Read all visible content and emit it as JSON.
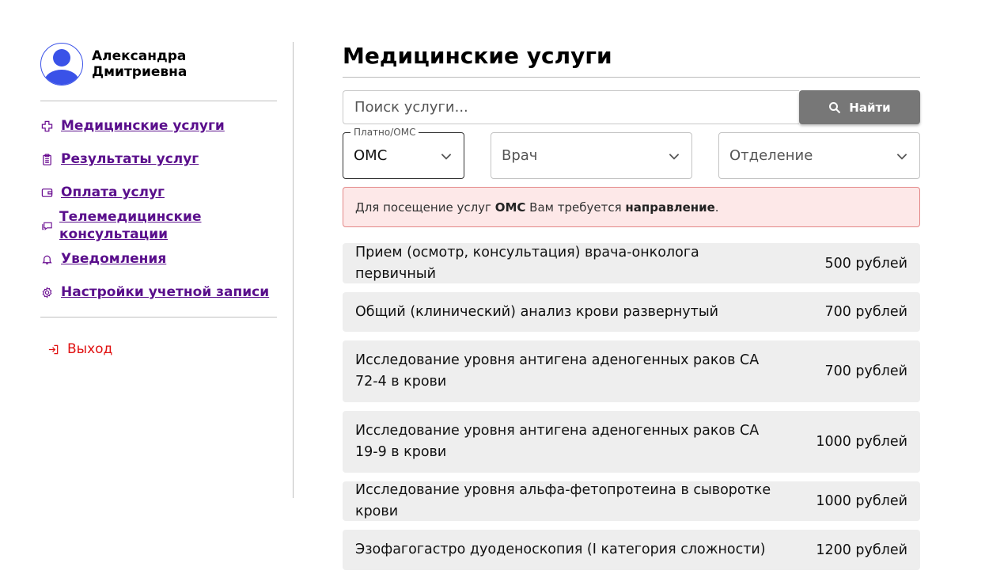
{
  "profile": {
    "name": "Александра Дмитриевна"
  },
  "nav": {
    "items": [
      {
        "label": "Медицинские услуги",
        "icon": "medical-cross-icon"
      },
      {
        "label": "Результаты услуг",
        "icon": "clipboard-icon"
      },
      {
        "label": "Оплата услуг",
        "icon": "wallet-icon"
      },
      {
        "label": "Телемедицинские консультации",
        "icon": "chat-icon"
      },
      {
        "label": "Уведомления",
        "icon": "bell-icon"
      },
      {
        "label": "Настройки учетной записи",
        "icon": "gear-icon"
      }
    ],
    "logout": {
      "label": "Выход",
      "icon": "logout-icon"
    }
  },
  "main": {
    "title": "Медицинские услуги",
    "search": {
      "placeholder": "Поиск услуги...",
      "button_label": "Найти"
    },
    "filters": {
      "payment": {
        "label": "Платно/ОМС",
        "value": "ОМС"
      },
      "doctor": {
        "value": "Врач"
      },
      "department": {
        "value": "Отделение"
      }
    },
    "alert": {
      "prefix": "Для посещение услуг ",
      "strong1": "ОМС",
      "middle": " Вам требуется ",
      "strong2": "направление",
      "suffix": "."
    },
    "services": [
      {
        "name": "Прием (осмотр, консультация) врача-онколога первичный",
        "price": "500 рублей"
      },
      {
        "name": "Общий (клинический) анализ крови развернутый",
        "price": "700 рублей"
      },
      {
        "name": "Исследование уровня антигена аденогенных раков CA 72-4 в крови",
        "price": "700 рублей"
      },
      {
        "name": "Исследование уровня антигена аденогенных раков CA 19-9 в крови",
        "price": "1000 рублей"
      },
      {
        "name": "Исследование уровня альфа-фетопротеина в сыворотке крови",
        "price": "1000 рублей"
      },
      {
        "name": "Эзофагогастро дуоденоскопия (I категория сложности)",
        "price": "1200 рублей"
      }
    ]
  },
  "colors": {
    "accent": "#5a0f8c",
    "avatar": "#3a52e8",
    "danger": "#e01010",
    "alert_bg": "#fde8e8"
  }
}
